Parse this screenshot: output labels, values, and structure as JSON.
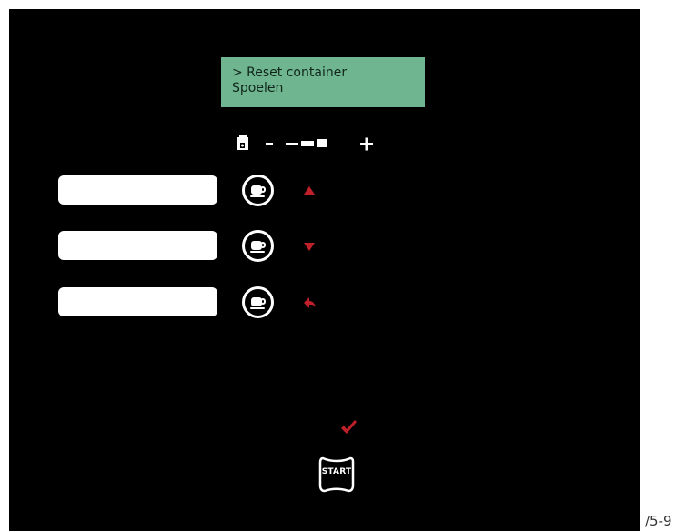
{
  "display": {
    "line1": "> Reset container",
    "line2": "Spoelen"
  },
  "strength_selector": {
    "bean_icon": "coffee-bean-container-icon",
    "minus": "–",
    "plus": "+",
    "level_icon": "strength-bars-icon"
  },
  "buttons": [
    {
      "slot_label": "",
      "cup_icon": "cup-icon",
      "nav_icon": "arrow-up-icon"
    },
    {
      "slot_label": "",
      "cup_icon": "cup-icon",
      "nav_icon": "arrow-down-icon"
    },
    {
      "slot_label": "",
      "cup_icon": "cup-icon",
      "nav_icon": "back-arrow-icon"
    }
  ],
  "confirm": {
    "check_icon": "checkmark-icon",
    "start_label": "START"
  },
  "colors": {
    "panel": "#000000",
    "lcd": "#6fb58f",
    "accent": "#c0202a"
  },
  "figure_id": "/5-9"
}
